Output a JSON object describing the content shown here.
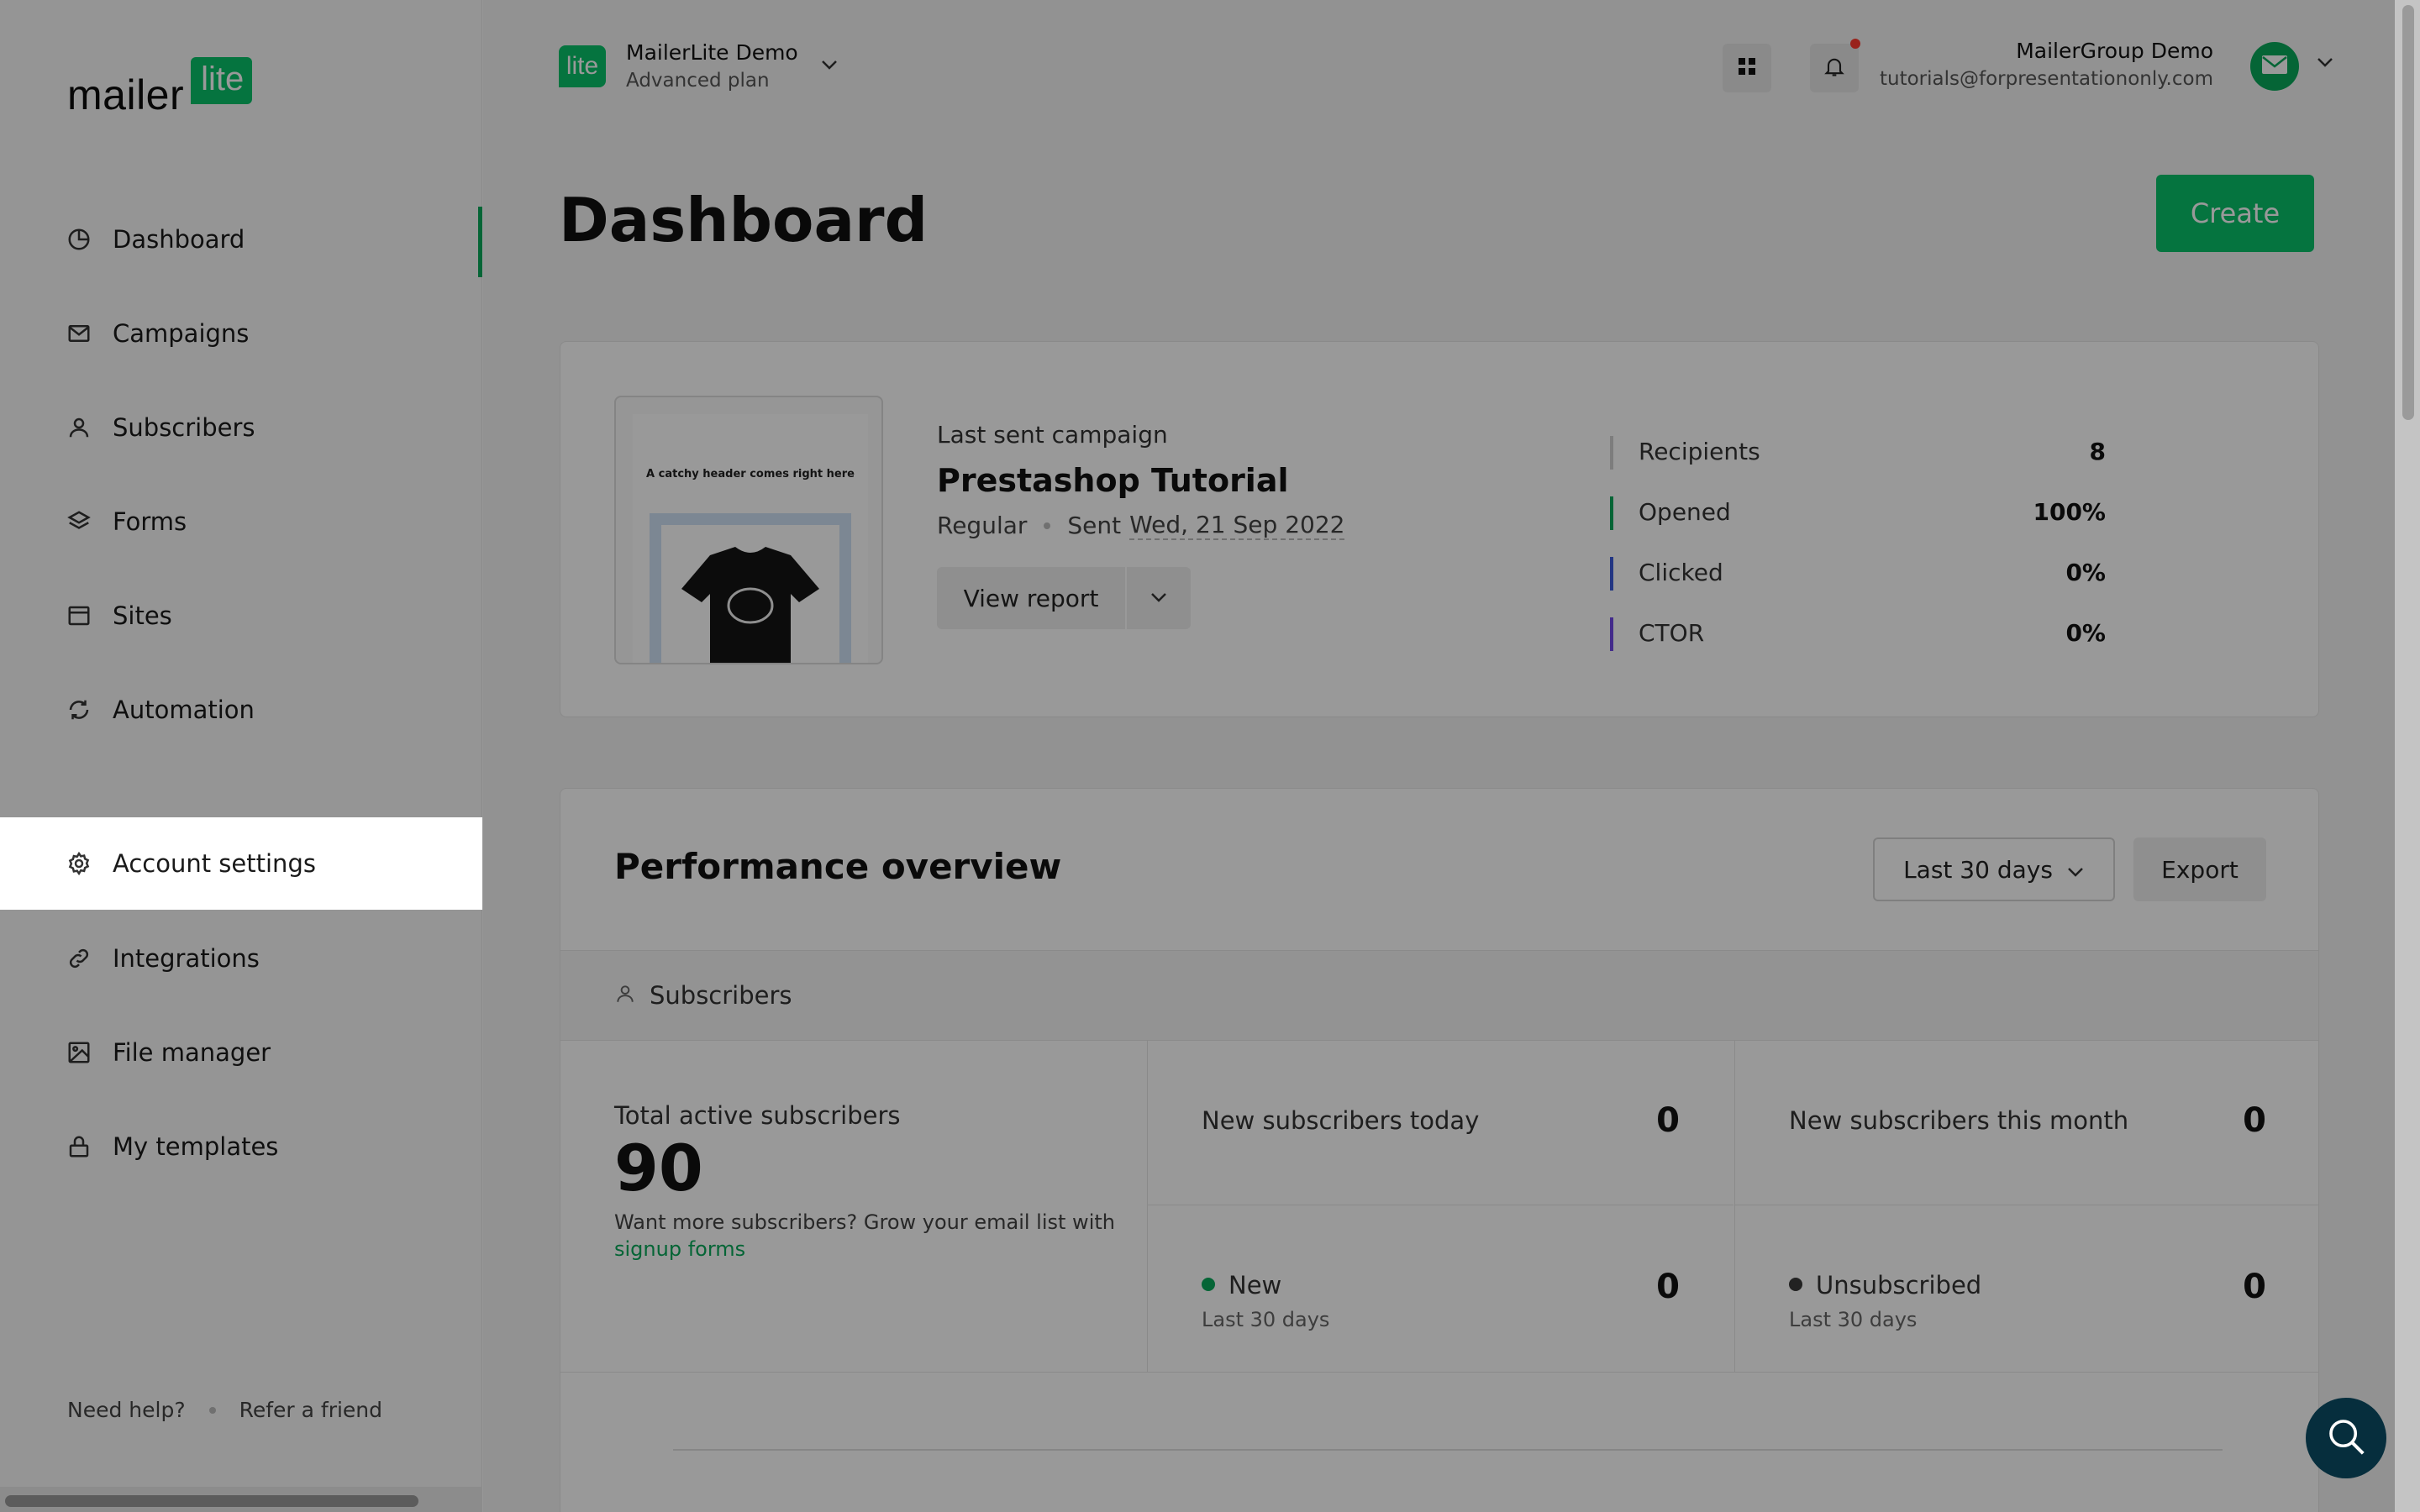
{
  "brand": {
    "logo_word": "mailer",
    "logo_badge": "lite"
  },
  "sidebar": {
    "items": [
      {
        "label": "Dashboard",
        "icon": "dashboard-icon"
      },
      {
        "label": "Campaigns",
        "icon": "mail-icon"
      },
      {
        "label": "Subscribers",
        "icon": "user-icon"
      },
      {
        "label": "Forms",
        "icon": "layers-icon"
      },
      {
        "label": "Sites",
        "icon": "browser-icon"
      },
      {
        "label": "Automation",
        "icon": "refresh-icon"
      },
      {
        "label": "Account settings",
        "icon": "gear-icon"
      },
      {
        "label": "Integrations",
        "icon": "link-icon"
      },
      {
        "label": "File manager",
        "icon": "image-icon"
      },
      {
        "label": "My templates",
        "icon": "lock-icon"
      }
    ],
    "footer": {
      "help": "Need help?",
      "refer": "Refer a friend"
    }
  },
  "topbar": {
    "account_badge": "lite",
    "account_name": "MailerLite Demo",
    "account_plan": "Advanced plan",
    "user_name": "MailerGroup Demo",
    "user_email": "tutorials@forpresentationonly.com"
  },
  "page": {
    "title": "Dashboard",
    "create_label": "Create"
  },
  "campaign": {
    "kicker": "Last sent campaign",
    "title": "Prestashop Tutorial",
    "type": "Regular",
    "sent_prefix": "Sent",
    "sent_date": "Wed, 21 Sep 2022",
    "view_report_label": "View report",
    "thumb_header": "A catchy header comes right here",
    "stats": [
      {
        "label": "Recipients",
        "value": "8",
        "color": "#d0d0d0"
      },
      {
        "label": "Opened",
        "value": "100%",
        "color": "#09a85a"
      },
      {
        "label": "Clicked",
        "value": "0%",
        "color": "#3b5bdb"
      },
      {
        "label": "CTOR",
        "value": "0%",
        "color": "#7048e8"
      }
    ]
  },
  "performance": {
    "title": "Performance overview",
    "range_label": "Last 30 days",
    "export_label": "Export",
    "subscribers_tab": "Subscribers",
    "total_label": "Total active subscribers",
    "total_value": "90",
    "help_question": "Want more subscribers?",
    "help_text": "Grow your email list with",
    "help_link": "signup forms",
    "new_today_label": "New subscribers today",
    "new_today_value": "0",
    "new_month_label": "New subscribers this month",
    "new_month_value": "0",
    "new_label": "New",
    "new_sub": "Last 30 days",
    "new_value": "0",
    "new_dot_color": "#09a85a",
    "unsub_label": "Unsubscribed",
    "unsub_sub": "Last 30 days",
    "unsub_value": "0",
    "unsub_dot_color": "#3a3a3a"
  },
  "colors": {
    "accent": "#09c269",
    "overlay": "rgba(0,0,0,0.4)"
  }
}
